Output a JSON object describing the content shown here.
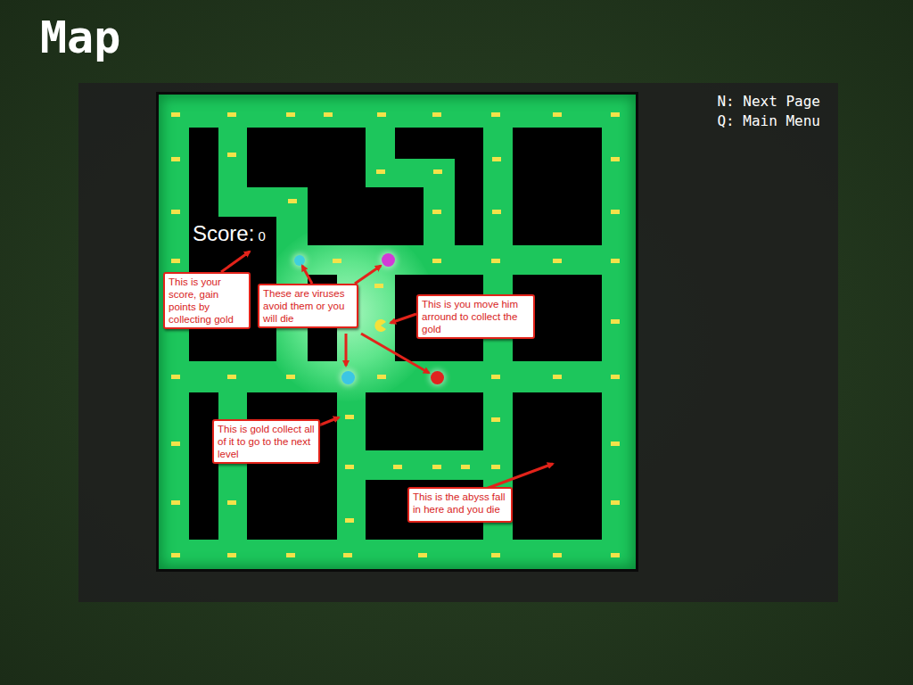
{
  "page": {
    "title": "Map"
  },
  "keys": [
    "N: Next Page",
    "Q: Main Menu"
  ],
  "game": {
    "score_label": "Score:",
    "score": "0",
    "viruses": [
      {
        "color": "#3fd0dc"
      },
      {
        "color": "#d23bd6"
      },
      {
        "color": "#3cc6e4"
      },
      {
        "color": "#e0231f"
      }
    ],
    "annotations": [
      "This is your score, gain points by collecting gold",
      "These are viruses avoid them or you will die",
      "This is you move him arround to collect the gold",
      "This is gold collect all of it to go to the next level",
      "This is the abyss fall in here and you die"
    ]
  }
}
